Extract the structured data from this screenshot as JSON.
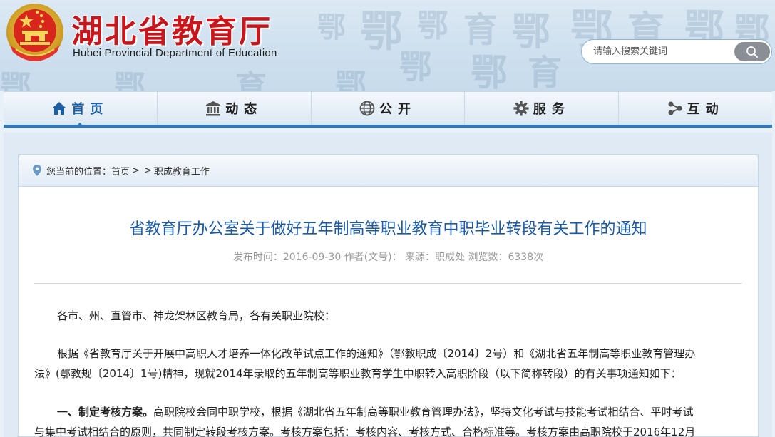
{
  "header": {
    "title": "湖北省教育厅",
    "subtitle": "Hubei Provincial Department of Education",
    "emblem_icon": "national-emblem-icon",
    "accent_color": "#c8161d"
  },
  "search": {
    "placeholder": "请输入搜索关键词",
    "button_icon": "search-icon"
  },
  "nav": {
    "items": [
      {
        "label": "首页",
        "icon": "home-icon",
        "active": true
      },
      {
        "label": "动态",
        "icon": "building-icon",
        "active": false
      },
      {
        "label": "公开",
        "icon": "globe-icon",
        "active": false
      },
      {
        "label": "服务",
        "icon": "gear-icon",
        "active": false
      },
      {
        "label": "互动",
        "icon": "share-icon",
        "active": false
      }
    ],
    "accent_color": "#2a79c4"
  },
  "breadcrumb": {
    "prefix": "您当前的位置：",
    "home": "首页",
    "separator": ">",
    "current": "职成教育工作"
  },
  "article": {
    "title": "省教育厅办公室关于做好五年制高等职业教育中职毕业转段有关工作的通知",
    "meta": "发布时间：2016-09-30 作者(文号)： 来源：职成处 浏览数：6338次",
    "salutation": "各市、州、直管市、神龙架林区教育局，各有关职业院校：",
    "para1_line1": "根据《省教育厅关于开展中高职人才培养一体化改革试点工作的通知》（鄂教职成〔2014〕2号）和《湖北省五年制高等职业教育管理办",
    "para1_line2": "法》(鄂教规〔2014〕1号)精神，现就2014年录取的五年制高等职业教育学生中职转入高职阶段（以下简称转段）的有关事项通知如下：",
    "para2_heading": "一、制定考核方案。",
    "para2_line1": "高职院校会同中职学校，根据《湖北省五年制高等职业教育管理办法》，坚持文化考试与技能考试相结合、平时考试",
    "para2_line2": "与集中考试相结合的原则，共同制定转段考核方案。考核方案包括：考核内容、考核方式、合格标准等。考核方案由高职院校于2016年12月"
  }
}
